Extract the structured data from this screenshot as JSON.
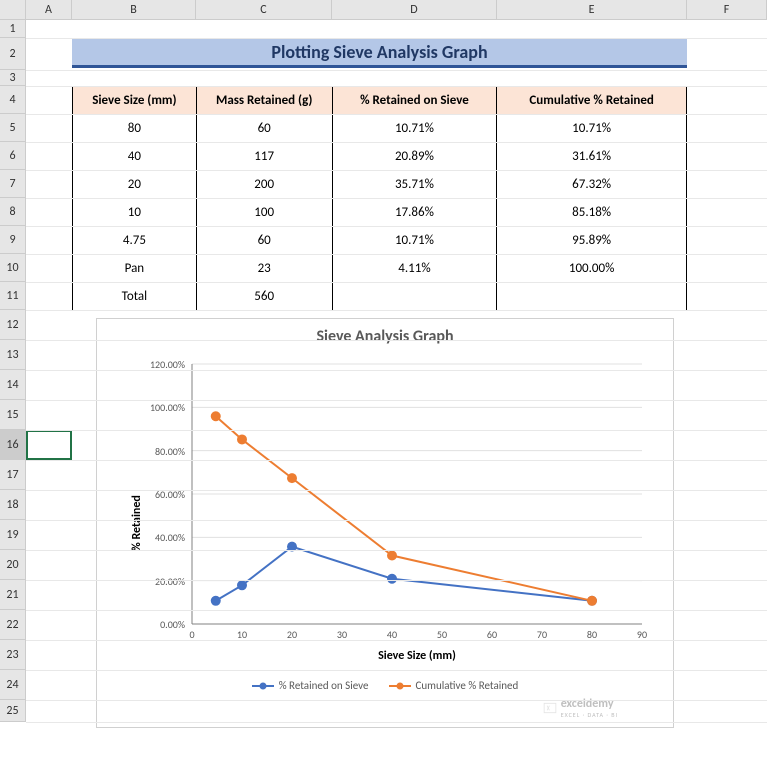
{
  "columns": [
    {
      "label": "A",
      "w": 46
    },
    {
      "label": "B",
      "w": 124
    },
    {
      "label": "C",
      "w": 136
    },
    {
      "label": "D",
      "w": 165
    },
    {
      "label": "E",
      "w": 190
    },
    {
      "label": "F",
      "w": 80
    }
  ],
  "rows": [
    {
      "n": "1",
      "h": 18
    },
    {
      "n": "2",
      "h": 32
    },
    {
      "n": "3",
      "h": 16
    },
    {
      "n": "4",
      "h": 28
    },
    {
      "n": "5",
      "h": 28
    },
    {
      "n": "6",
      "h": 28
    },
    {
      "n": "7",
      "h": 28
    },
    {
      "n": "8",
      "h": 28
    },
    {
      "n": "9",
      "h": 28
    },
    {
      "n": "10",
      "h": 28
    },
    {
      "n": "11",
      "h": 28
    },
    {
      "n": "12",
      "h": 30
    },
    {
      "n": "13",
      "h": 30
    },
    {
      "n": "14",
      "h": 30
    },
    {
      "n": "15",
      "h": 30
    },
    {
      "n": "16",
      "h": 30
    },
    {
      "n": "17",
      "h": 30
    },
    {
      "n": "18",
      "h": 30
    },
    {
      "n": "19",
      "h": 30
    },
    {
      "n": "20",
      "h": 30
    },
    {
      "n": "21",
      "h": 30
    },
    {
      "n": "22",
      "h": 30
    },
    {
      "n": "23",
      "h": 30
    },
    {
      "n": "24",
      "h": 30
    },
    {
      "n": "25",
      "h": 22
    }
  ],
  "selected_row": "16",
  "title": "Plotting Sieve Analysis Graph",
  "table": {
    "headers": [
      "Sieve Size (mm)",
      "Mass Retained (g)",
      "% Retained on Sieve",
      "Cumulative % Retained"
    ],
    "rows": [
      [
        "80",
        "60",
        "10.71%",
        "10.71%"
      ],
      [
        "40",
        "117",
        "20.89%",
        "31.61%"
      ],
      [
        "20",
        "200",
        "35.71%",
        "67.32%"
      ],
      [
        "10",
        "100",
        "17.86%",
        "85.18%"
      ],
      [
        "4.75",
        "60",
        "10.71%",
        "95.89%"
      ],
      [
        "Pan",
        "23",
        "4.11%",
        "100.00%"
      ],
      [
        "Total",
        "560",
        "",
        ""
      ]
    ]
  },
  "chart": {
    "title": "Sieve Analysis Graph",
    "xlabel": "Sieve Size (mm)",
    "ylabel": "% Retained",
    "x_ticks": [
      "0",
      "10",
      "20",
      "30",
      "40",
      "50",
      "60",
      "70",
      "80",
      "90"
    ],
    "y_ticks": [
      "0.00%",
      "20.00%",
      "40.00%",
      "60.00%",
      "80.00%",
      "100.00%",
      "120.00%"
    ],
    "legend": [
      "% Retained on Sieve",
      "Cumulative % Retained"
    ],
    "colors": {
      "series1": "#4472c4",
      "series2": "#ed7d31"
    }
  },
  "chart_data": {
    "type": "line",
    "title": "Sieve Analysis Graph",
    "xlabel": "Sieve Size (mm)",
    "ylabel": "% Retained",
    "xlim": [
      0,
      90
    ],
    "ylim": [
      0,
      120
    ],
    "series": [
      {
        "name": "% Retained on Sieve",
        "color": "#4472c4",
        "x": [
          4.75,
          10,
          20,
          40,
          80
        ],
        "y": [
          10.71,
          17.86,
          35.71,
          20.89,
          10.71
        ]
      },
      {
        "name": "Cumulative % Retained",
        "color": "#ed7d31",
        "x": [
          4.75,
          10,
          20,
          40,
          80
        ],
        "y": [
          95.89,
          85.18,
          67.32,
          31.61,
          10.71
        ]
      }
    ]
  },
  "watermark": {
    "brand": "exceldemy",
    "tag": "EXCEL · DATA · BI"
  }
}
